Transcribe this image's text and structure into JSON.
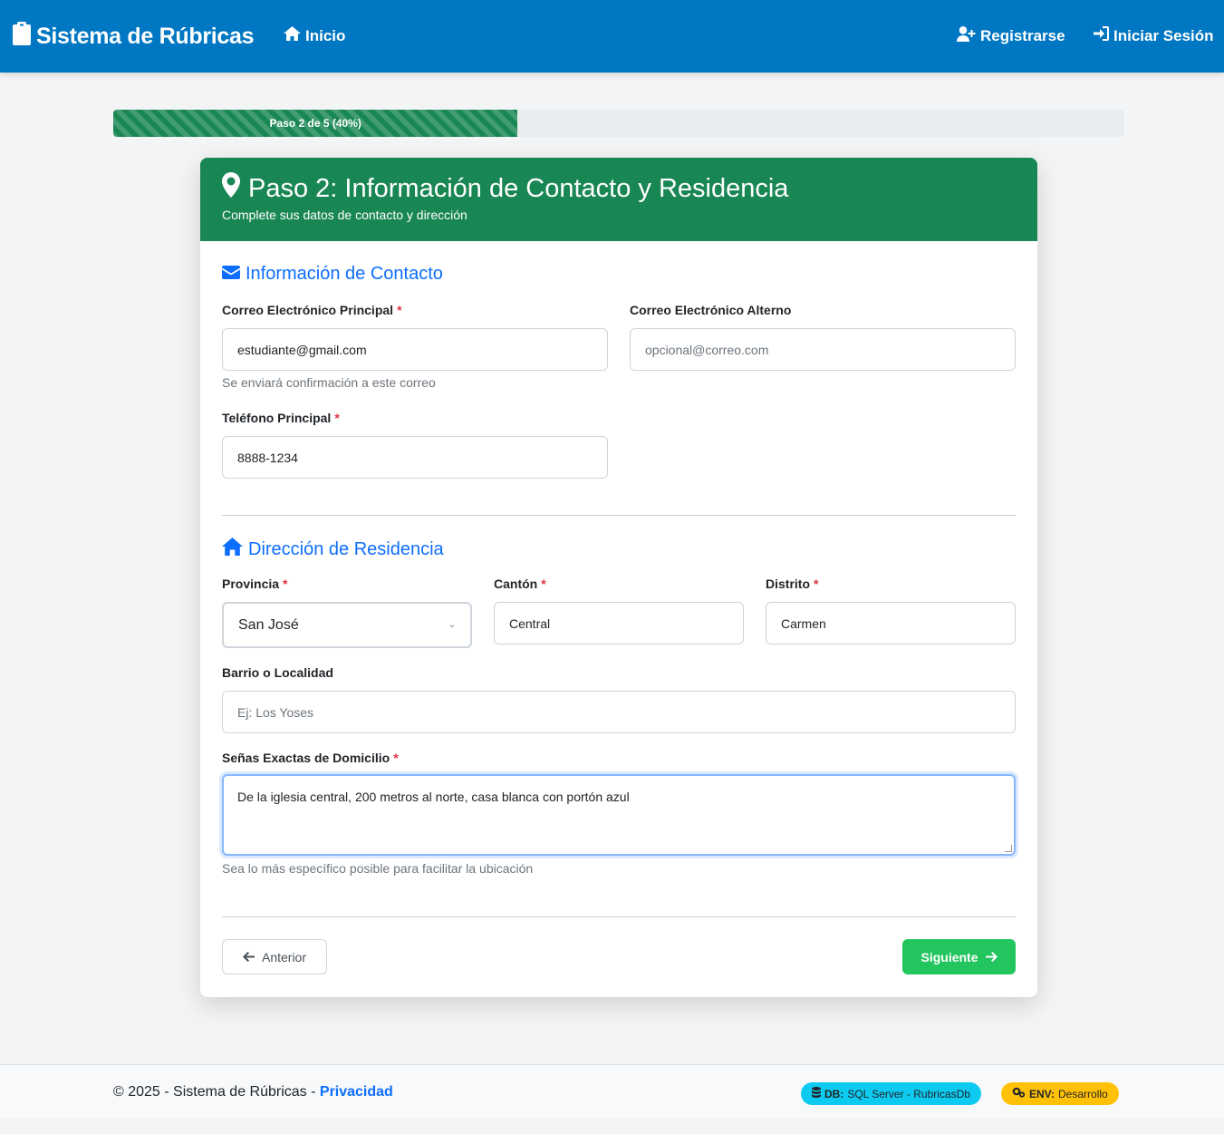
{
  "navbar": {
    "brand": "Sistema de Rúbricas",
    "inicio": "Inicio",
    "registrarse": "Registrarse",
    "login": "Iniciar Sesión"
  },
  "progress": {
    "label": "Paso 2 de 5 (40%)",
    "percent": 40
  },
  "card": {
    "title": "Paso 2: Información de Contacto y Residencia",
    "subtitle": "Complete sus datos de contacto y dirección"
  },
  "contacto": {
    "title": "Información de Contacto",
    "email_label": "Correo Electrónico Principal",
    "email_value": "estudiante@gmail.com",
    "email_help": "Se enviará confirmación a este correo",
    "alt_email_label": "Correo Electrónico Alterno",
    "alt_email_placeholder": "opcional@correo.com",
    "phone_label": "Teléfono Principal",
    "phone_value": "8888-1234"
  },
  "residencia": {
    "title": "Dirección de Residencia",
    "provincia_label": "Provincia",
    "provincia_value": "San José",
    "canton_label": "Cantón",
    "canton_value": "Central",
    "distrito_label": "Distrito",
    "distrito_value": "Carmen",
    "barrio_label": "Barrio o Localidad",
    "barrio_placeholder": "Ej: Los Yoses",
    "senas_label": "Señas Exactas de Domicilio",
    "senas_value": "De la iglesia central, 200 metros al norte, casa blanca con portón azul",
    "senas_help": "Sea lo más específico posible para facilitar la ubicación"
  },
  "buttons": {
    "prev": "Anterior",
    "next": "Siguiente"
  },
  "required_mark": "*",
  "footer": {
    "copyright": "© 2025 - Sistema de Rúbricas - ",
    "privacy": "Privacidad",
    "db_key": "DB:",
    "db_value": "SQL Server - RubricasDb",
    "env_key": "ENV:",
    "env_value": "Desarrollo"
  },
  "colors": {
    "navbar": "#0077c2",
    "card_header": "#198754",
    "accent": "#0d6efd",
    "next_button": "#22c55e"
  }
}
